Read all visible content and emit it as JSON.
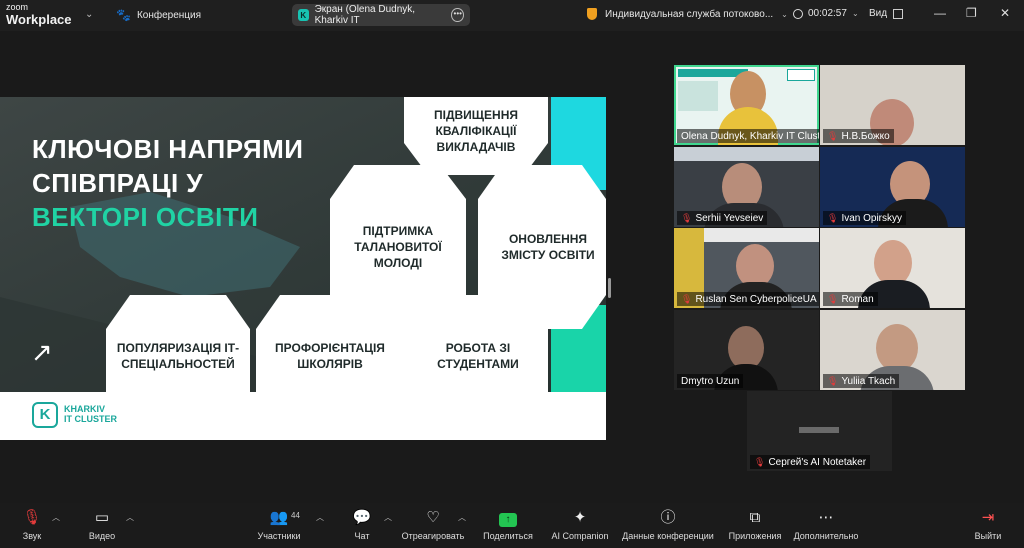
{
  "titlebar": {
    "brand_line1": "zoom",
    "brand_line2": "Workplace",
    "conference_label": "Конференция",
    "screen_share_label": "Экран (Olena Dudnyk, Kharkiv IT",
    "stream_label": "Индивидуальная служба потоково...",
    "timer": "00:02:57",
    "view_label": "Вид"
  },
  "slide": {
    "title_line1": "КЛЮЧОВІ НАПРЯМИ",
    "title_line2": "СПІВПРАЦІ У",
    "title_line3": "ВЕКТОРІ ОСВІТИ",
    "hex1": "ПІДВИЩЕННЯ КВАЛІФІКАЦІЇ ВИКЛАДАЧІВ",
    "hex2": "ПІДТРИМКА ТАЛАНОВИТОЇ МОЛОДІ",
    "hex3": "ОНОВЛЕННЯ ЗМІСТУ ОСВІТИ",
    "hex4": "ПОПУЛЯРИЗАЦІЯ ІТ-СПЕЦІАЛЬНОСТЕЙ",
    "hex5": "ПРОФОРІЄНТАЦІЯ ШКОЛЯРІВ",
    "hex6": "РОБОТА ЗІ СТУДЕНТАМИ",
    "logo_letter": "K",
    "logo_line1": "KHARKIV",
    "logo_line2": "IT CLUSTER",
    "accent_color": "#20d3a4"
  },
  "participants": [
    {
      "name": "Olena Dudnyk, Kharkiv IT Clust...",
      "muted": false
    },
    {
      "name": "Н.В.Божко",
      "muted": true
    },
    {
      "name": "Serhii Yevseiev",
      "muted": true
    },
    {
      "name": "Ivan Opirskyy",
      "muted": true
    },
    {
      "name": "Ruslan Sen CyberpoliceUA",
      "muted": true
    },
    {
      "name": "Roman",
      "muted": true
    },
    {
      "name": "Dmytro Uzun",
      "muted": false
    },
    {
      "name": "Yuliia Tkach",
      "muted": true
    },
    {
      "name": "Сергей's AI Notetaker",
      "muted": true
    }
  ],
  "toolbar": {
    "audio": "Звук",
    "video": "Видео",
    "participants": "Участники",
    "participants_count": "44",
    "chat": "Чат",
    "react": "Отреагировать",
    "share": "Поделиться",
    "ai_companion": "AI Companion",
    "meeting_info": "Данные конференции",
    "apps": "Приложения",
    "more": "Дополнительно",
    "leave": "Выйти"
  }
}
